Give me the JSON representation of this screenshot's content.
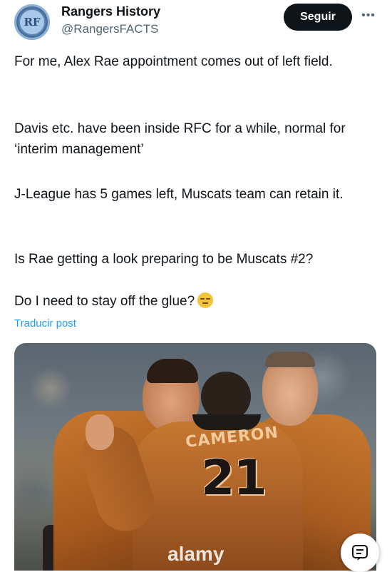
{
  "author": {
    "name": "Rangers History",
    "handle": "@RangersFACTS",
    "avatar_initials": "RF"
  },
  "actions": {
    "follow_label": "Seguir",
    "more_label": "•••"
  },
  "tweet": {
    "paragraphs": [
      "For me, Alex Rae appointment comes out of left field.",
      "Davis etc. have been inside RFC for a while, normal for ‘interim management’",
      "J-League has 5 games left, Muscats team can retain it.",
      "Is Rae getting a look preparing to be Muscats #2?",
      "Do I need to stay off the glue?"
    ],
    "emoji": "pensive-face"
  },
  "translate_label": "Traducir post",
  "photo": {
    "shirt_name": "CAMERON",
    "shirt_number": "21",
    "watermark": "alamy"
  },
  "colors": {
    "follow_bg": "#0f1419",
    "link": "#1d9bf0",
    "secondary_text": "#536471",
    "kit_orange": "#c57830"
  }
}
